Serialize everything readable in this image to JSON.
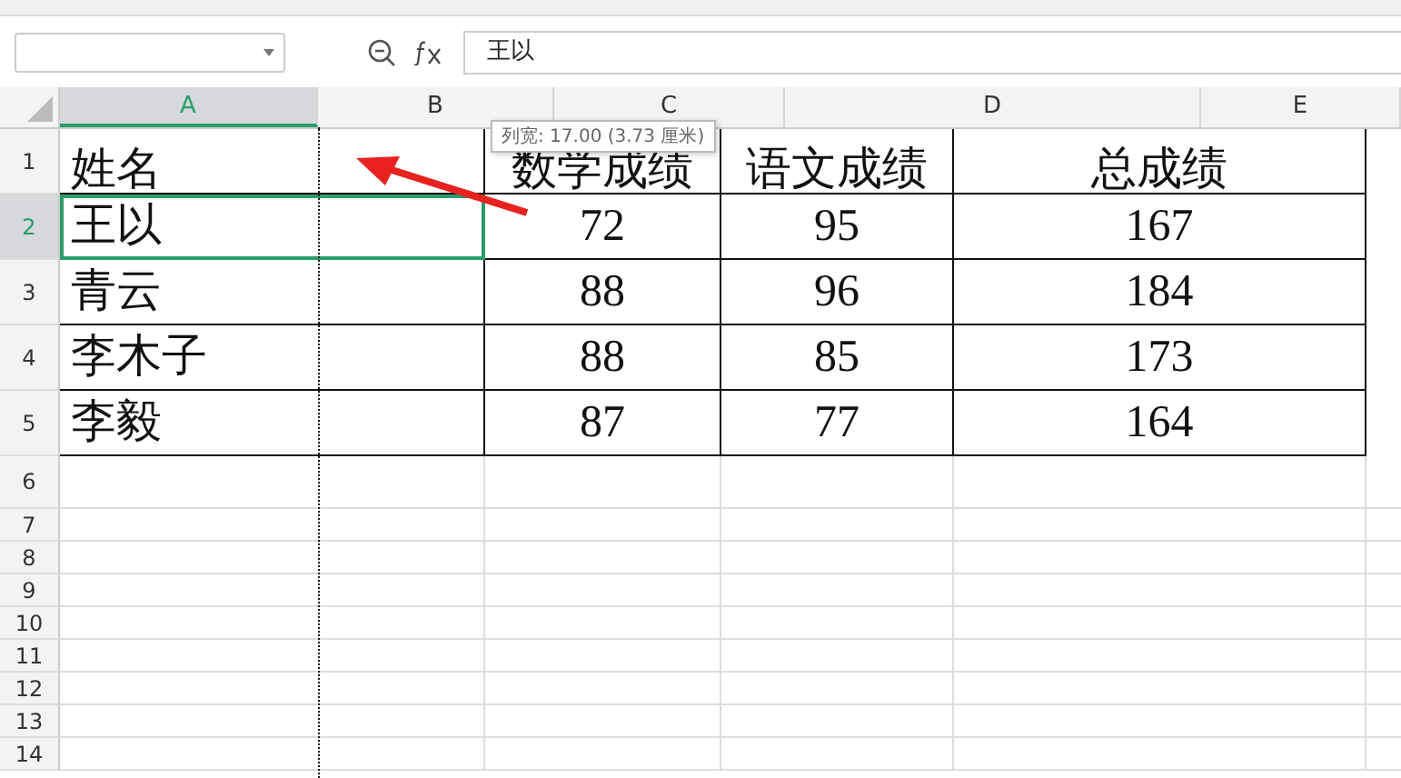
{
  "formula_bar": {
    "formula": "王以"
  },
  "columns": [
    {
      "label": "A",
      "selected": true
    },
    {
      "label": "B",
      "selected": false
    },
    {
      "label": "C",
      "selected": false
    },
    {
      "label": "D",
      "selected": false
    },
    {
      "label": "E",
      "selected": false
    }
  ],
  "rows": [
    {
      "number": "1",
      "selected": false,
      "cells": [
        "姓名",
        "数学成绩",
        "语文成绩",
        "总成绩"
      ]
    },
    {
      "number": "2",
      "selected": true,
      "cells": [
        "王以",
        "72",
        "95",
        "167"
      ]
    },
    {
      "number": "3",
      "selected": false,
      "cells": [
        "青云",
        "88",
        "96",
        "184"
      ]
    },
    {
      "number": "4",
      "selected": false,
      "cells": [
        "李木子",
        "88",
        "85",
        "173"
      ]
    },
    {
      "number": "5",
      "selected": false,
      "cells": [
        "李毅",
        "87",
        "77",
        "164"
      ]
    }
  ],
  "empty_rows": [
    "6",
    "7",
    "8",
    "9",
    "10",
    "11",
    "12",
    "13",
    "14"
  ],
  "tooltip": "列宽: 17.00 (3.73 厘米)"
}
